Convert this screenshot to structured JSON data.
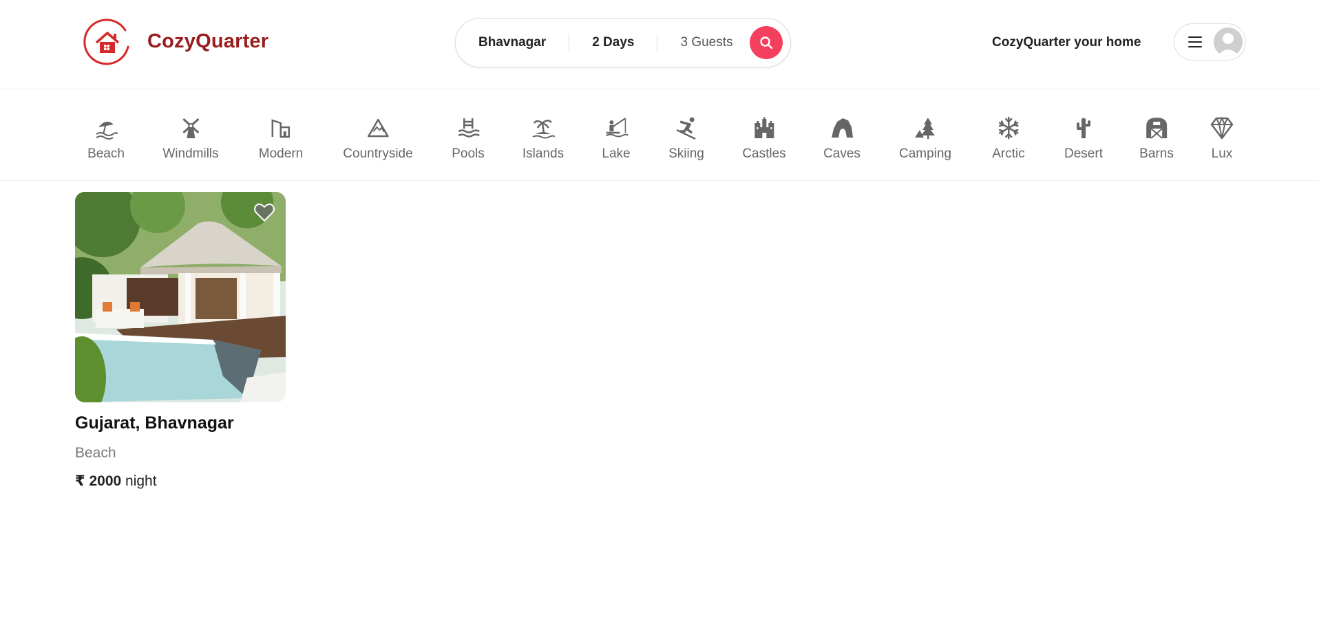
{
  "brand": {
    "name": "CozyQuarter"
  },
  "search": {
    "location": "Bhavnagar",
    "duration": "2 Days",
    "guests": "3 Guests"
  },
  "header": {
    "host_link": "CozyQuarter your home"
  },
  "categories": [
    {
      "label": "Beach",
      "icon": "beach-icon"
    },
    {
      "label": "Windmills",
      "icon": "windmill-icon"
    },
    {
      "label": "Modern",
      "icon": "modern-building-icon"
    },
    {
      "label": "Countryside",
      "icon": "mountain-icon"
    },
    {
      "label": "Pools",
      "icon": "pool-icon"
    },
    {
      "label": "Islands",
      "icon": "island-icon"
    },
    {
      "label": "Lake",
      "icon": "fishing-icon"
    },
    {
      "label": "Skiing",
      "icon": "skiing-icon"
    },
    {
      "label": "Castles",
      "icon": "castle-icon"
    },
    {
      "label": "Caves",
      "icon": "cave-icon"
    },
    {
      "label": "Camping",
      "icon": "camping-icon"
    },
    {
      "label": "Arctic",
      "icon": "snowflake-icon"
    },
    {
      "label": "Desert",
      "icon": "cactus-icon"
    },
    {
      "label": "Barns",
      "icon": "barn-icon"
    },
    {
      "label": "Lux",
      "icon": "diamond-icon"
    }
  ],
  "listings": [
    {
      "location": "Gujarat, Bhavnagar",
      "category": "Beach",
      "currency": "₹",
      "price": "2000",
      "unit": "night"
    }
  ],
  "colors": {
    "brand": "#9b1c1c",
    "accent": "#f43f5e",
    "logo_red": "#e0322d"
  }
}
